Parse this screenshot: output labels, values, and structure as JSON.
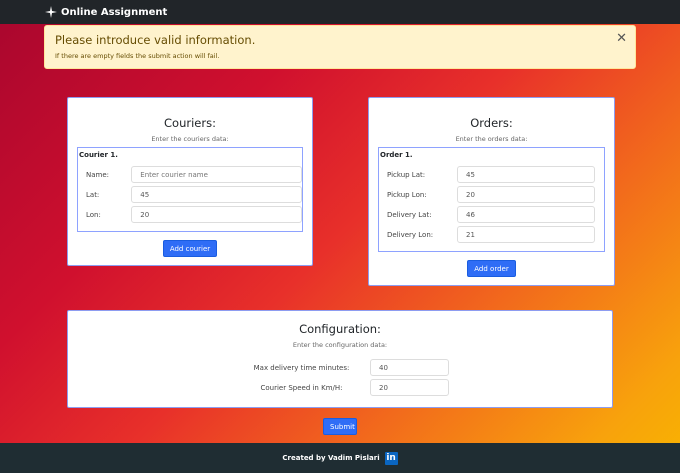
{
  "nav": {
    "title": "Online Assignment"
  },
  "alert": {
    "title": "Please introduce valid information.",
    "text": "If there are empty fields the submit action will fail."
  },
  "couriers": {
    "title": "Couriers:",
    "subtitle": "Enter the couriers data:",
    "legend": "Courier 1.",
    "fields": [
      {
        "label": "Name:",
        "value": "",
        "placeholder": "Enter courier name"
      },
      {
        "label": "Lat:",
        "value": "45"
      },
      {
        "label": "Lon:",
        "value": "20"
      }
    ],
    "button": "Add courier"
  },
  "orders": {
    "title": "Orders:",
    "subtitle": "Enter the orders data:",
    "legend": "Order 1.",
    "fields": [
      {
        "label": "Pickup Lat:",
        "value": "45"
      },
      {
        "label": "Pickup Lon:",
        "value": "20"
      },
      {
        "label": "Delivery Lat:",
        "value": "46"
      },
      {
        "label": "Delivery Lon:",
        "value": "21"
      }
    ],
    "button": "Add order"
  },
  "config": {
    "title": "Configuration:",
    "subtitle": "Enter the configuration data:",
    "fields": [
      {
        "label": "Max delivery time minutes:",
        "value": "40"
      },
      {
        "label": "Courier Speed in Km/H:",
        "value": "20"
      }
    ]
  },
  "submit": "Submit",
  "footer": {
    "text": "Created by Vadim Pislari",
    "linkedin": "in"
  }
}
